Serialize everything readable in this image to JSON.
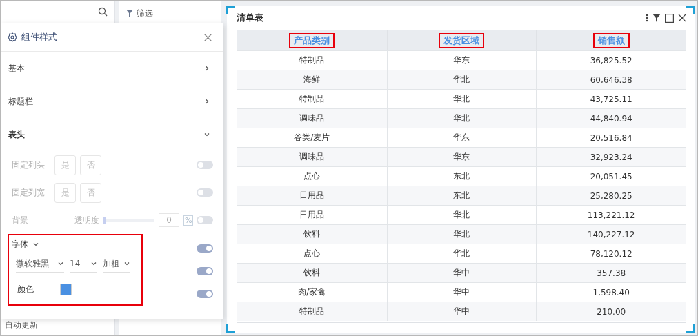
{
  "sidebar": {
    "footer_text": "自动更新"
  },
  "filter_panel": {
    "title": "筛选"
  },
  "style_panel": {
    "title": "组件样式",
    "sections": [
      {
        "label": "基本",
        "expanded": false
      },
      {
        "label": "标题栏",
        "expanded": false
      },
      {
        "label": "表头",
        "expanded": true
      }
    ],
    "settings": [
      {
        "kind": "choice",
        "label": "固定列头",
        "options": [
          "是",
          "否"
        ],
        "disabled": true,
        "on": false
      },
      {
        "kind": "choice",
        "label": "固定列宽",
        "options": [
          "是",
          "否"
        ],
        "disabled": true,
        "on": false
      },
      {
        "kind": "background",
        "label": "背景",
        "checked": false,
        "opacity_label": "透明度",
        "level": 0,
        "value": "0",
        "unit": "%",
        "disabled": true,
        "on": false
      },
      {
        "kind": "font-header",
        "label": "字体",
        "disabled": false,
        "on": true
      },
      {
        "kind": "font",
        "face": "微软雅黑",
        "size": "14",
        "weight": "加粗",
        "on": true
      },
      {
        "kind": "color",
        "label": "颜色",
        "color": "#4a90e2",
        "disabled": false,
        "on": true
      }
    ]
  },
  "widget": {
    "title": "清单表",
    "columns": [
      "产品类别",
      "发货区域",
      "销售额"
    ],
    "rows": [
      [
        "特制品",
        "华东",
        "36,825.52"
      ],
      [
        "海鲜",
        "华北",
        "60,646.38"
      ],
      [
        "特制品",
        "华北",
        "43,725.11"
      ],
      [
        "调味品",
        "华北",
        "44,840.94"
      ],
      [
        "谷类/麦片",
        "华东",
        "20,516.84"
      ],
      [
        "调味品",
        "华东",
        "32,923.24"
      ],
      [
        "点心",
        "东北",
        "20,051.45"
      ],
      [
        "日用品",
        "东北",
        "25,280.25"
      ],
      [
        "日用品",
        "华北",
        "113,221.12"
      ],
      [
        "饮料",
        "华北",
        "140,227.12"
      ],
      [
        "点心",
        "华北",
        "78,120.12"
      ],
      [
        "饮料",
        "华中",
        "357.38"
      ],
      [
        "肉/家禽",
        "华中",
        "1,598.40"
      ],
      [
        "特制品",
        "华中",
        "210.00"
      ]
    ]
  }
}
